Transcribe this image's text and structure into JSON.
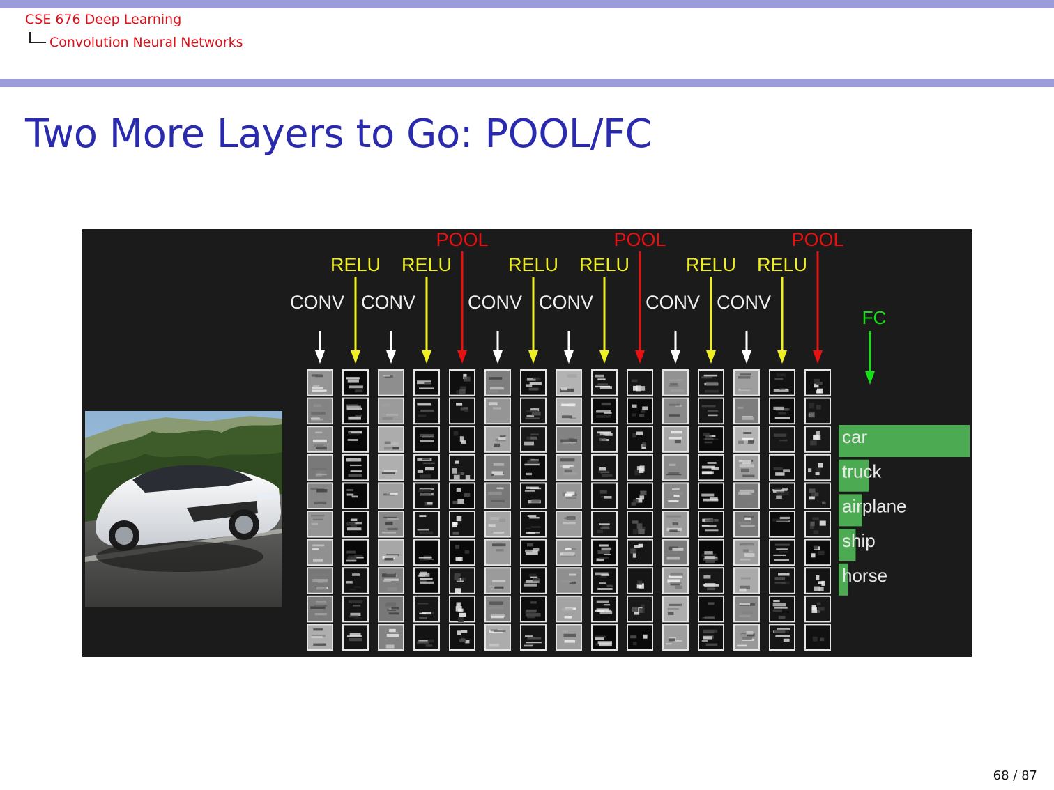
{
  "header": {
    "course": "CSE 676 Deep Learning",
    "section": "Convolution Neural Networks"
  },
  "slide": {
    "title": "Two More Layers to Go: POOL/FC"
  },
  "figure": {
    "layer_labels": [
      {
        "label": "CONV",
        "type": "conv"
      },
      {
        "label": "RELU",
        "type": "relu"
      },
      {
        "label": "CONV",
        "type": "conv"
      },
      {
        "label": "RELU",
        "type": "relu"
      },
      {
        "label": "POOL",
        "type": "pool"
      },
      {
        "label": "CONV",
        "type": "conv"
      },
      {
        "label": "RELU",
        "type": "relu"
      },
      {
        "label": "CONV",
        "type": "conv"
      },
      {
        "label": "RELU",
        "type": "relu"
      },
      {
        "label": "POOL",
        "type": "pool"
      },
      {
        "label": "CONV",
        "type": "conv"
      },
      {
        "label": "RELU",
        "type": "relu"
      },
      {
        "label": "CONV",
        "type": "conv"
      },
      {
        "label": "RELU",
        "type": "relu"
      },
      {
        "label": "POOL",
        "type": "pool"
      }
    ],
    "fc_label": "FC",
    "colors": {
      "conv": "#ffffff",
      "relu": "#f0f020",
      "pool": "#e81010",
      "fc": "#16e016",
      "bar": "#4cab52",
      "background": "#1b1b1b"
    },
    "predictions": [
      {
        "label": "car",
        "score": 1.0
      },
      {
        "label": "truck",
        "score": 0.23
      },
      {
        "label": "airplane",
        "score": 0.18
      },
      {
        "label": "ship",
        "score": 0.13
      },
      {
        "label": "horse",
        "score": 0.07
      }
    ]
  },
  "footer": {
    "page": "68 / 87"
  }
}
